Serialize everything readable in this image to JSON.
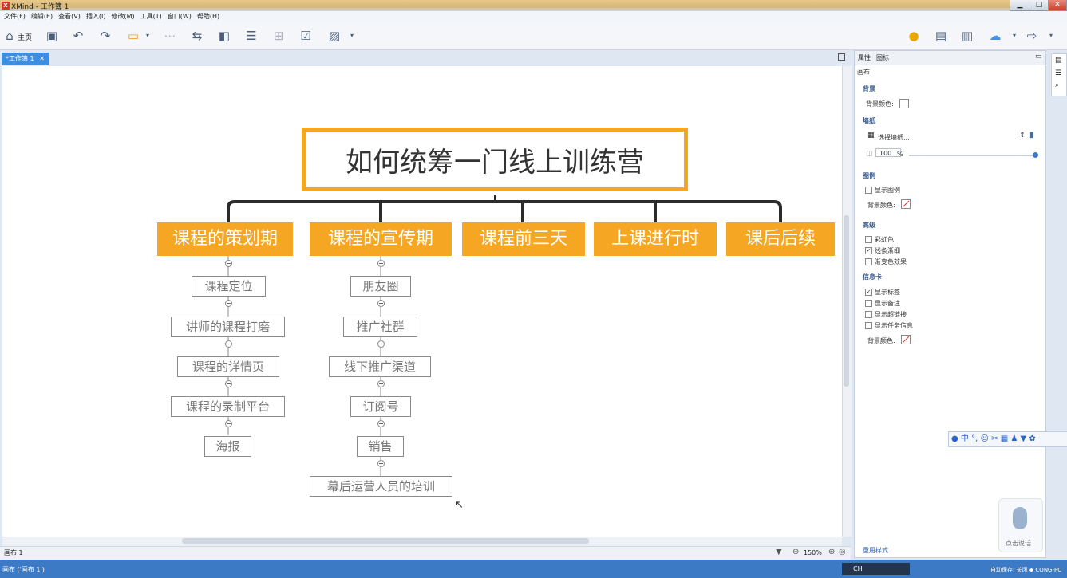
{
  "window": {
    "title": "XMind - 工作簿 1",
    "logo": "X",
    "minimize": "▁",
    "maximize": "□",
    "close": "✕"
  },
  "menu": [
    "文件(F)",
    "编辑(E)",
    "查看(V)",
    "插入(I)",
    "修改(M)",
    "工具(T)",
    "窗口(W)",
    "帮助(H)"
  ],
  "toolbar": {
    "home_label": "主页"
  },
  "tab": {
    "label": "*工作簿 1",
    "close": "✕"
  },
  "mindmap": {
    "central": "如何统筹一门线上训练营",
    "branches": [
      "课程的策划期",
      "课程的宣传期",
      "课程前三天",
      "上课进行时",
      "课后后续"
    ],
    "branch1_children": [
      "课程定位",
      "讲师的课程打磨",
      "课程的详情页",
      "课程的录制平台",
      "海报"
    ],
    "branch2_children": [
      "朋友圈",
      "推广社群",
      "线下推广渠道",
      "订阅号",
      "销售",
      "幕后运营人员的培训"
    ]
  },
  "sheet": {
    "name": "画布 1",
    "zoom": "150%"
  },
  "status": {
    "left": "画布 ('画布 1')",
    "right": "自动保存: 关闭  ◆  CONG-PC",
    "tray": "CH"
  },
  "panel": {
    "tabs": [
      "属性",
      "图标"
    ],
    "title": "画布",
    "background_section": "背景",
    "bg_color_label": "背景颜色:",
    "wallpaper_section": "墙纸",
    "wallpaper_select": "选择墙纸...",
    "opacity_value": "100",
    "opacity_unit": "%",
    "legend_section": "图例",
    "show_legend": "显示图例",
    "legend_bg_label": "背景颜色:",
    "advanced_section": "高级",
    "rainbow": "彩虹色",
    "taper": "线条渐细",
    "gradient": "渐变色效果",
    "info_section": "信息卡",
    "show_labels": "显示标签",
    "show_notes": "显示备注",
    "show_links": "显示超链接",
    "show_tasks": "显示任务信息",
    "info_bg_label": "背景颜色:",
    "checked": "✓",
    "footer_link": "重用样式"
  },
  "ime": {
    "mode": "中"
  },
  "voice": {
    "label": "点击说话"
  }
}
